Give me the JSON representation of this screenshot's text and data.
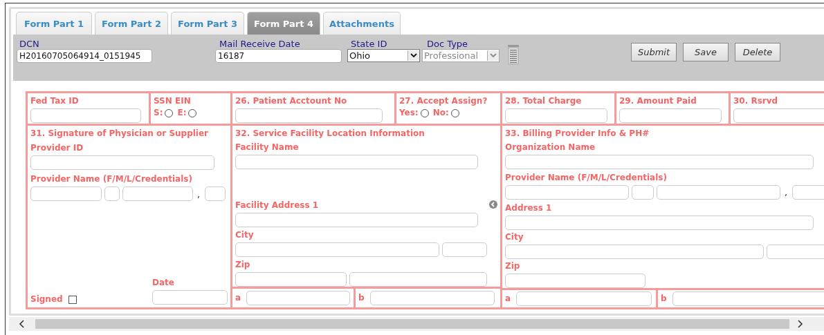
{
  "tabs": [
    {
      "label": "Form Part 1",
      "selected": false
    },
    {
      "label": "Form Part 2",
      "selected": false
    },
    {
      "label": "Form Part 3",
      "selected": false
    },
    {
      "label": "Form Part 4",
      "selected": true
    },
    {
      "label": "Attachments",
      "selected": false
    }
  ],
  "header": {
    "dcn": {
      "label": "DCN",
      "value": "H20160705064914_0151945"
    },
    "mail_receive_date": {
      "label": "Mail Receive Date",
      "value": "16187"
    },
    "state_id": {
      "label": "State ID",
      "value": "Ohio",
      "disabled": false
    },
    "doc_type": {
      "label": "Doc Type",
      "value": "Professional",
      "disabled": true
    },
    "buttons": [
      "Submit",
      "Save",
      "Delete"
    ]
  },
  "form": {
    "top_row": [
      {
        "kind": "field",
        "label": "Fed Tax ID"
      },
      {
        "kind": "radio",
        "label": "SSN EIN",
        "options": [
          {
            "label": "S:",
            "checked": false
          },
          {
            "label": "E:",
            "checked": false
          }
        ]
      },
      {
        "kind": "field",
        "label": "26. Patient Acctount No"
      },
      {
        "kind": "radio",
        "label": "27. Accept Assign?",
        "options": [
          {
            "label": "Yes:",
            "checked": false
          },
          {
            "label": "No:",
            "checked": false
          }
        ]
      },
      {
        "kind": "field",
        "label": "28. Total Charge"
      },
      {
        "kind": "field",
        "label": "29. Amount Paid"
      },
      {
        "kind": "field",
        "label": "30. Rsrvd"
      }
    ],
    "signature": {
      "title": "31. Signature of Physician or Supplier",
      "provider_id_label": "Provider ID",
      "provider_name_label": "Provider Name (F/M/L/Credentials)",
      "comma": ",",
      "signed_label": "Signed",
      "signed": false,
      "date_label": "Date"
    },
    "facility": {
      "title": "32. Service Facility Location Information",
      "name_label": "Facility Name",
      "address_label": "Facility Address 1",
      "city_label": "City",
      "zip_label": "Zip",
      "a_label": "a",
      "b_label": "b"
    },
    "billing": {
      "title": "33. Billing Provider Info & PH#",
      "org_label": "Organization Name",
      "provider_name_label": "Provider Name (F/M/L/Credentials)",
      "comma": ",",
      "address_label": "Address 1",
      "city_label": "City",
      "zip_label": "Zip",
      "a_label": "a",
      "b_label": "b"
    }
  }
}
